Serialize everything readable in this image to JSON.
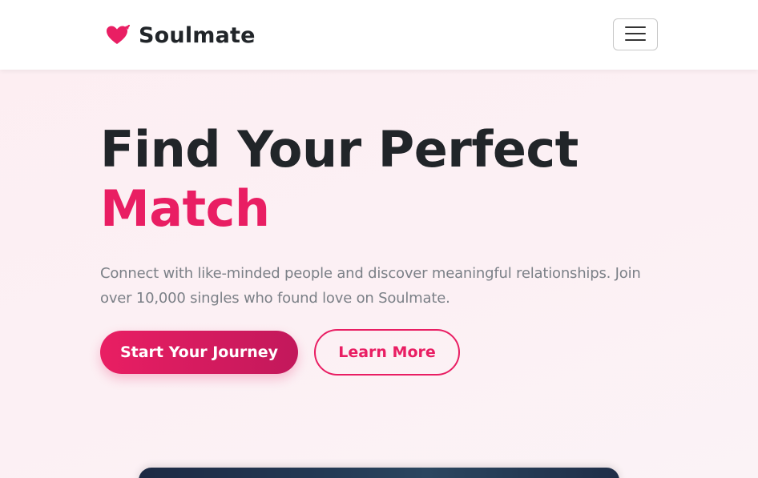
{
  "nav": {
    "brand": "Soulmate",
    "brand_icon": "heart-arrow-icon",
    "menu_icon": "hamburger-menu-icon"
  },
  "hero": {
    "title_line1": "Find Your Perfect",
    "title_line2": "Match",
    "subtitle": "Connect with like-minded people and discover meaningful relationships. Join over 10,000 singles who found love on Soulmate.",
    "primary_button": "Start Your Journey",
    "secondary_button": "Learn More"
  },
  "colors": {
    "accent": "#e91e63",
    "accent_dark": "#c2185b",
    "text_dark": "#212529",
    "text_muted": "#7b8087",
    "hero_background": "#fdeef2"
  }
}
